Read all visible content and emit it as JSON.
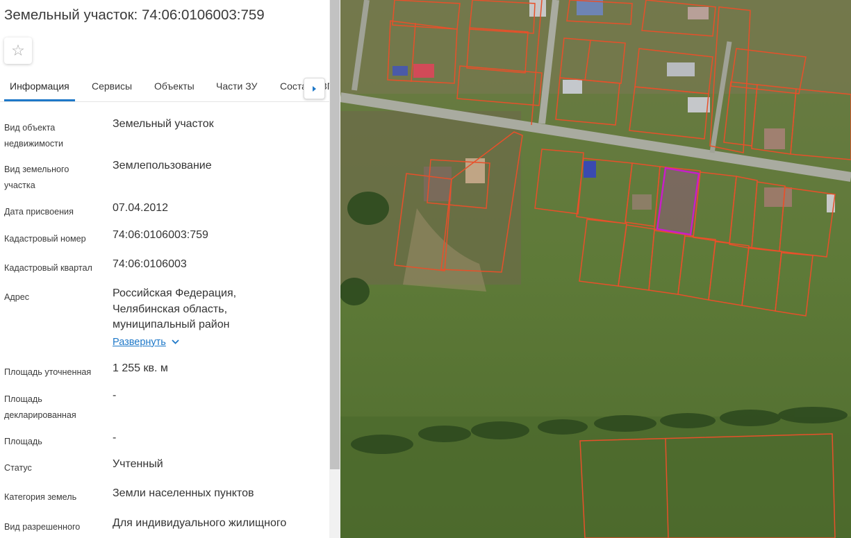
{
  "title": "Земельный участок: 74:06:0106003:759",
  "favorite": {
    "icon": "star-outline-icon"
  },
  "tabs": [
    {
      "label": "Информация"
    },
    {
      "label": "Сервисы"
    },
    {
      "label": "Объекты"
    },
    {
      "label": "Части ЗУ"
    },
    {
      "label": "Состав ЕЗП"
    }
  ],
  "tabs_scroll": {
    "icon": "triangle-right-icon"
  },
  "fields": {
    "object_type": {
      "label": "Вид объекта недвижимости",
      "value": "Земельный участок"
    },
    "plot_type": {
      "label": "Вид земельного участка",
      "value": "Землепользование"
    },
    "assign_date": {
      "label": "Дата присвоения",
      "value": "07.04.2012"
    },
    "cadastral_no": {
      "label": "Кадастровый номер",
      "value": "74:06:0106003:759"
    },
    "quarter": {
      "label": "Кадастровый квартал",
      "value": "74:06:0106003"
    },
    "address": {
      "label": "Адрес",
      "lines": [
        "Российская Федерация,",
        "Челябинская область,",
        "муниципальный район"
      ],
      "expand_label": "Развернуть",
      "expand_icon": "chevron-down-icon"
    },
    "area_refined": {
      "label": "Площадь уточненная",
      "value": "1 255 кв. м"
    },
    "area_declared": {
      "label": "Площадь декларированная",
      "value": "-"
    },
    "area": {
      "label": "Площадь",
      "value": "-"
    },
    "status": {
      "label": "Статус",
      "value": "Учтенный"
    },
    "land_category": {
      "label": "Категория земель",
      "value": "Земли населенных пунктов"
    },
    "permitted_use": {
      "label": "Вид разрешенного",
      "value": "Для индивидуального жилищного"
    }
  },
  "map": {
    "colors": {
      "boundary": "#e8502a",
      "selected": "#c81ec8",
      "road": "#a9aba0",
      "field": "#5f7a3c",
      "trees": "#2f4a22"
    }
  }
}
